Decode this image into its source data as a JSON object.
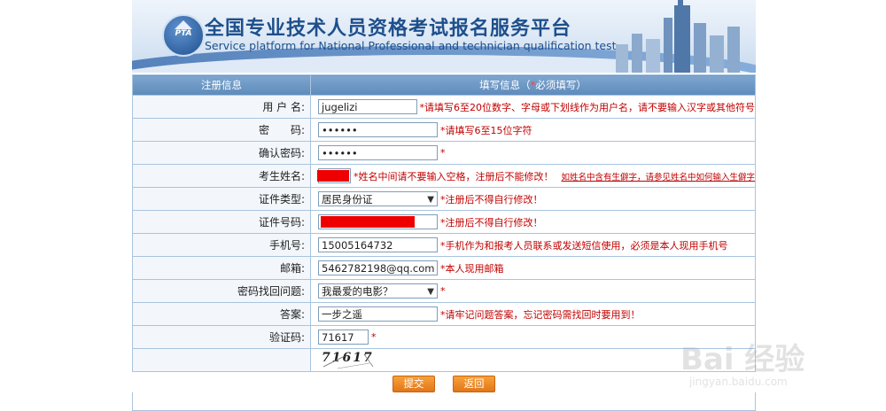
{
  "banner": {
    "logo_text": "PTA",
    "title_cn": "全国专业技术人员资格考试报名服务平台",
    "title_en": "Service platform for National Professional and technician  qualification test"
  },
  "table": {
    "header_left": "注册信息",
    "header_right_prefix": "填写信息（",
    "header_right_star": "*",
    "header_right_suffix": "必须填写）"
  },
  "rows": {
    "username": {
      "label": "用 户 名:",
      "value": "jugelizi",
      "hint": "*请填写6至20位数字、字母或下划线作为用户名，请不要输入汉字或其他符号"
    },
    "password": {
      "label": "密　　码:",
      "value": "••••••",
      "hint": "*请填写6至15位字符"
    },
    "confirm": {
      "label": "确认密码:",
      "value": "••••••",
      "hint": "*"
    },
    "name": {
      "label": "考生姓名:",
      "hint": "*姓名中间请不要输入空格，注册后不能修改！",
      "link": "如姓名中含有生僻字，请参见姓名中如何输入生僻字"
    },
    "id_type": {
      "label": "证件类型:",
      "value": "居民身份证",
      "hint": "*注册后不得自行修改！"
    },
    "id_number": {
      "label": "证件号码:",
      "hint": "*注册后不得自行修改！"
    },
    "phone": {
      "label": "手机号:",
      "value": "15005164732",
      "hint": "*手机作为和报考人员联系或发送短信使用，必须是本人现用手机号"
    },
    "email": {
      "label": "邮箱:",
      "value": "5462782198@qq.com",
      "hint": "*本人现用邮箱"
    },
    "question": {
      "label": "密码找回问题:",
      "value": "我最爱的电影？",
      "hint": "*"
    },
    "answer": {
      "label": "答案:",
      "value": "一步之遥",
      "hint": "*请牢记问题答案，忘记密码需找回时要用到！"
    },
    "captcha": {
      "label": "验证码:",
      "value": "71617",
      "hint": "*",
      "image_text": "71617"
    }
  },
  "buttons": {
    "submit": "提交",
    "back": "返回"
  },
  "watermark": {
    "brand": "Bai 经验",
    "site": "jingyan.baidu.com"
  }
}
